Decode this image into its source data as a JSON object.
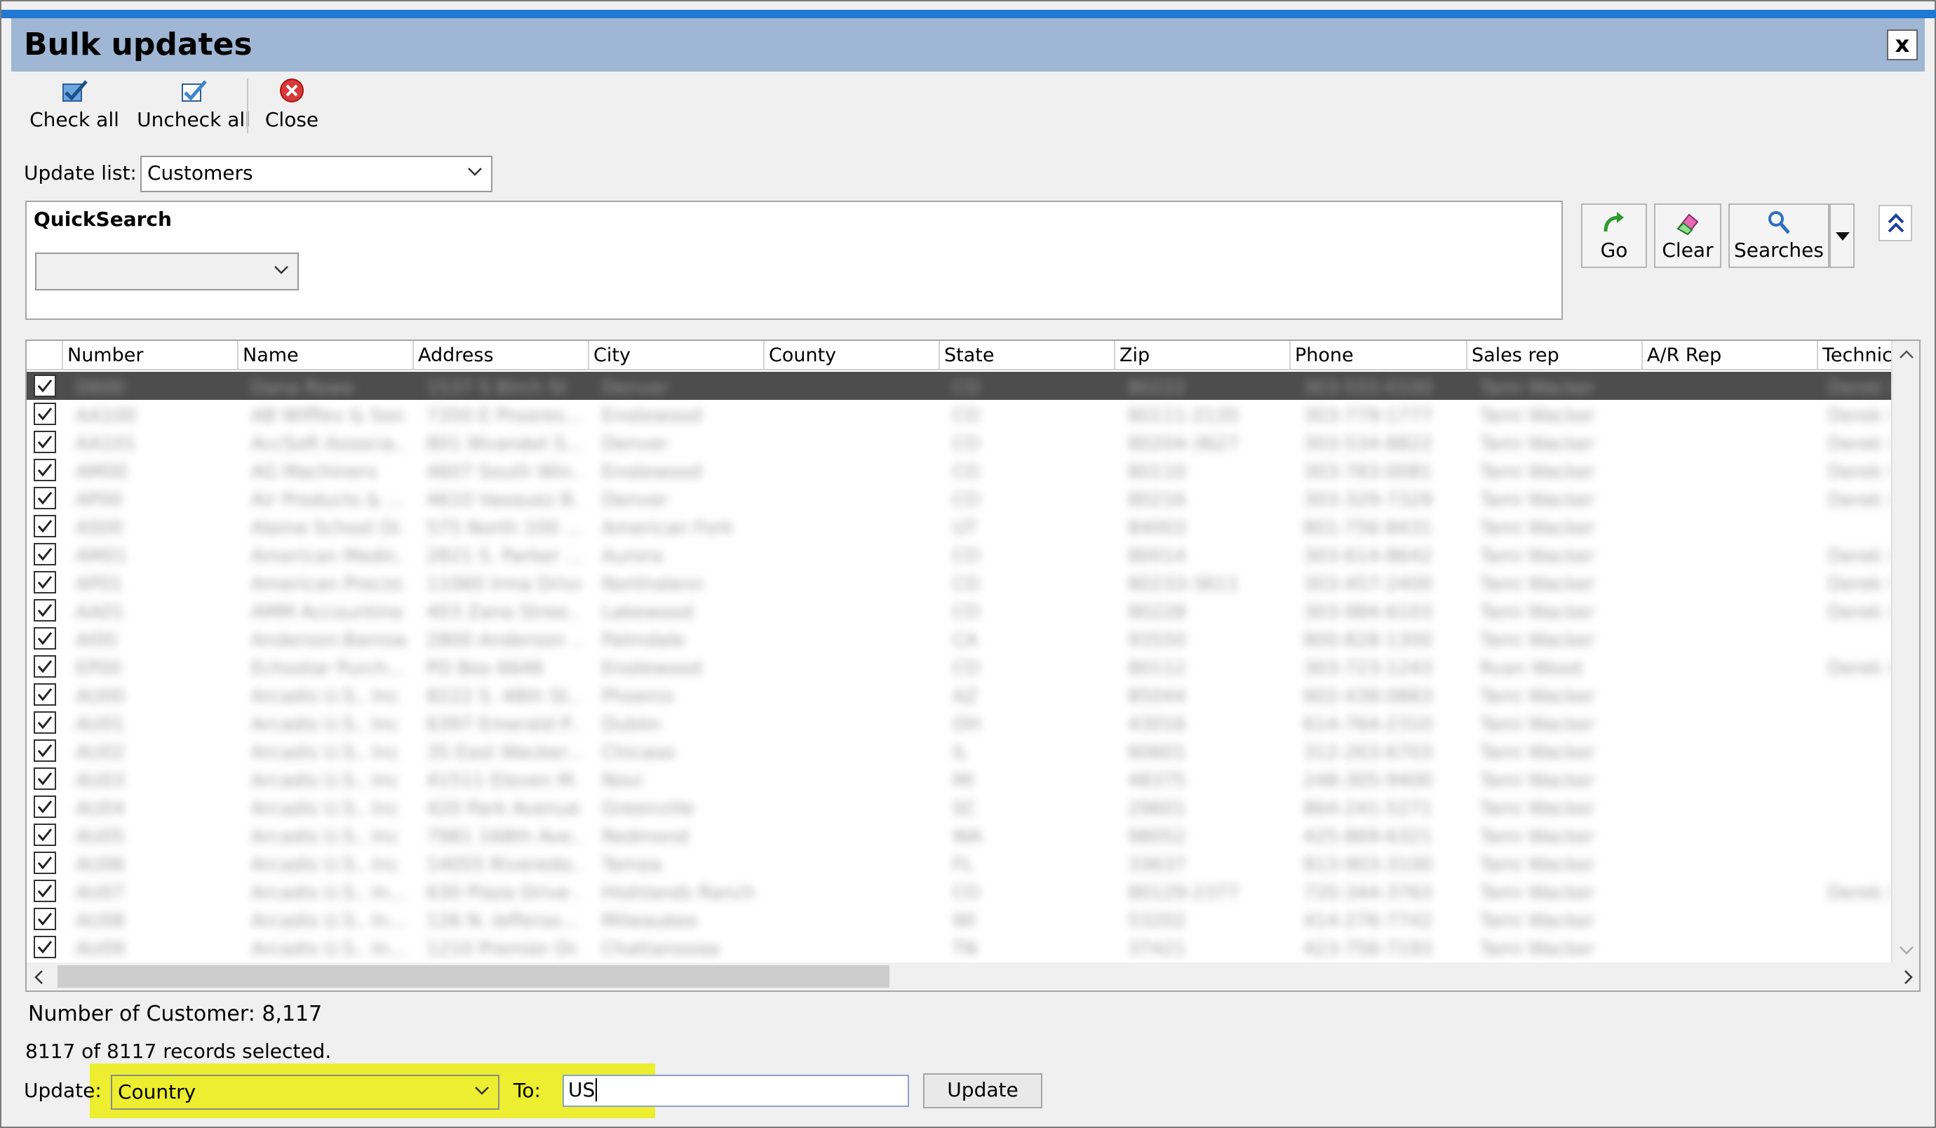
{
  "window": {
    "title": "Bulk updates",
    "close_label": "x"
  },
  "toolbar": {
    "check_all": "Check all",
    "uncheck_all": "Uncheck all",
    "close": "Close"
  },
  "update_list": {
    "label": "Update list:",
    "value": "Customers"
  },
  "quicksearch": {
    "title": "QuickSearch",
    "value": ""
  },
  "search_buttons": {
    "go": "Go",
    "clear": "Clear",
    "searches": "Searches"
  },
  "grid": {
    "columns": [
      "Number",
      "Name",
      "Address",
      "City",
      "County",
      "State",
      "Zip",
      "Phone",
      "Sales rep",
      "A/R Rep",
      "Technici"
    ],
    "rows": [
      {
        "number": "D600",
        "name": "Dana Rowe",
        "address": "1537 S Birch St",
        "city": "Denver",
        "state": "CO",
        "zip": "80222",
        "phone": "303-555-0100",
        "rep": "Tami Wacker",
        "tech": "Derek B"
      },
      {
        "number": "AA100",
        "name": "AB Wiffley & Sons",
        "address": "7350 E Progres...",
        "city": "Englewood",
        "state": "CO",
        "zip": "80111-2135",
        "phone": "303-779-1777",
        "rep": "Tami Wacker",
        "tech": "Derek B"
      },
      {
        "number": "AA101",
        "name": "AccSoft Associa...",
        "address": "801 Wyandot S...",
        "city": "Denver",
        "state": "CO",
        "zip": "80204-3627",
        "phone": "303-534-8822",
        "rep": "Tami Wacker",
        "tech": "Derek B"
      },
      {
        "number": "AM00",
        "name": "AG Machinery",
        "address": "4607 South Win...",
        "city": "Englewood",
        "state": "CO",
        "zip": "80110",
        "phone": "303-783-0081",
        "rep": "Tami Wacker",
        "tech": "Derek B"
      },
      {
        "number": "AP00",
        "name": "Air Products & ...",
        "address": "4610 Vasquez B...",
        "city": "Denver",
        "state": "CO",
        "zip": "80216",
        "phone": "303-329-7329",
        "rep": "Tami Wacker",
        "tech": "Derek B"
      },
      {
        "number": "AS00",
        "name": "Alpine School Di...",
        "address": "575 North 100 ...",
        "city": "American Fork",
        "state": "UT",
        "zip": "84003",
        "phone": "801-756-8431",
        "rep": "Tami Wacker",
        "tech": ""
      },
      {
        "number": "AM01",
        "name": "American Medic...",
        "address": "2821 S. Parker ...",
        "city": "Aurora",
        "state": "CO",
        "zip": "80014",
        "phone": "303-614-8642",
        "rep": "Tami Wacker",
        "tech": "Derek B"
      },
      {
        "number": "AP01",
        "name": "American Precisi...",
        "address": "11060 Irma Drive",
        "city": "Northglenn",
        "state": "CO",
        "zip": "80233-3611",
        "phone": "303-457-2400",
        "rep": "Tami Wacker",
        "tech": "Derek B"
      },
      {
        "number": "AA01",
        "name": "AMM Accounting",
        "address": "403 Zang Stree...",
        "city": "Lakewood",
        "state": "CO",
        "zip": "80228",
        "phone": "303-984-6103",
        "rep": "Tami Wacker",
        "tech": "Derek B"
      },
      {
        "number": "AI00",
        "name": "Anderson-Barrows",
        "address": "2800 Anderson ...",
        "city": "Palmdale",
        "state": "CA",
        "zip": "93550",
        "phone": "800-828-1300",
        "rep": "Tami Wacker",
        "tech": ""
      },
      {
        "number": "EP00",
        "name": "Echostar Purch...",
        "address": "PO Box 6646",
        "city": "Englewood",
        "state": "CO",
        "zip": "80112",
        "phone": "303-723-1243",
        "rep": "Ryan Wood",
        "tech": "Derek B"
      },
      {
        "number": "AU00",
        "name": "Arcadis U.S., Inc",
        "address": "8222 S. 48th St...",
        "city": "Phoenix",
        "state": "AZ",
        "zip": "85044",
        "phone": "602-438-0883",
        "rep": "Tami Wacker",
        "tech": ""
      },
      {
        "number": "AU01",
        "name": "Arcadis U.S., Inc",
        "address": "6397 Emerald P...",
        "city": "Dublin",
        "state": "OH",
        "zip": "43016",
        "phone": "614-764-2310",
        "rep": "Tami Wacker",
        "tech": ""
      },
      {
        "number": "AU02",
        "name": "Arcadis U.S., Inc",
        "address": "35 East Wacker...",
        "city": "Chicago",
        "state": "IL",
        "zip": "60601",
        "phone": "312-263-6703",
        "rep": "Tami Wacker",
        "tech": ""
      },
      {
        "number": "AU03",
        "name": "Arcadis U.S., Inc",
        "address": "41511 Eleven M...",
        "city": "Novi",
        "state": "MI",
        "zip": "48375",
        "phone": "248-305-9400",
        "rep": "Tami Wacker",
        "tech": ""
      },
      {
        "number": "AU04",
        "name": "Arcadis U.S., Inc",
        "address": "420 Park Avenue",
        "city": "Greenville",
        "state": "SC",
        "zip": "29601",
        "phone": "864-241-5271",
        "rep": "Tami Wacker",
        "tech": ""
      },
      {
        "number": "AU05",
        "name": "Arcadis U.S., Inc",
        "address": "7981 168th Ave...",
        "city": "Redmond",
        "state": "WA",
        "zip": "98052",
        "phone": "425-869-6321",
        "rep": "Tami Wacker",
        "tech": ""
      },
      {
        "number": "AU06",
        "name": "Arcadis U.S., Inc",
        "address": "14055 Riveredg...",
        "city": "Tampa",
        "state": "FL",
        "zip": "33637",
        "phone": "813-903-3100",
        "rep": "Tami Wacker",
        "tech": ""
      },
      {
        "number": "AU07",
        "name": "Arcadis U.S., In...",
        "address": "630 Plaza Drive ...",
        "city": "Highlands Ranch",
        "state": "CO",
        "zip": "80129-2377",
        "phone": "720-344-3763",
        "rep": "Tami Wacker",
        "tech": "Derek B"
      },
      {
        "number": "AU08",
        "name": "Arcadis U.S., In...",
        "address": "126 N. Jefferso...",
        "city": "Milwaukee",
        "state": "WI",
        "zip": "53202",
        "phone": "414-276-7742",
        "rep": "Tami Wacker",
        "tech": ""
      },
      {
        "number": "AU09",
        "name": "Arcadis U.S., In...",
        "address": "1210 Premier Dr...",
        "city": "Chattanooga",
        "state": "TN",
        "zip": "37421",
        "phone": "423-756-7193",
        "rep": "Tami Wacker",
        "tech": ""
      }
    ]
  },
  "status": {
    "count": "Number of Customer: 8,117",
    "selected": "8117 of 8117 records selected."
  },
  "update": {
    "label": "Update:",
    "field_value": "Country",
    "to_label": "To:",
    "to_value": "US",
    "button": "Update"
  },
  "colors": {
    "highlight": "#ecee2f",
    "title_bar": "#9fb7d5",
    "accent": "#1f78d1"
  }
}
